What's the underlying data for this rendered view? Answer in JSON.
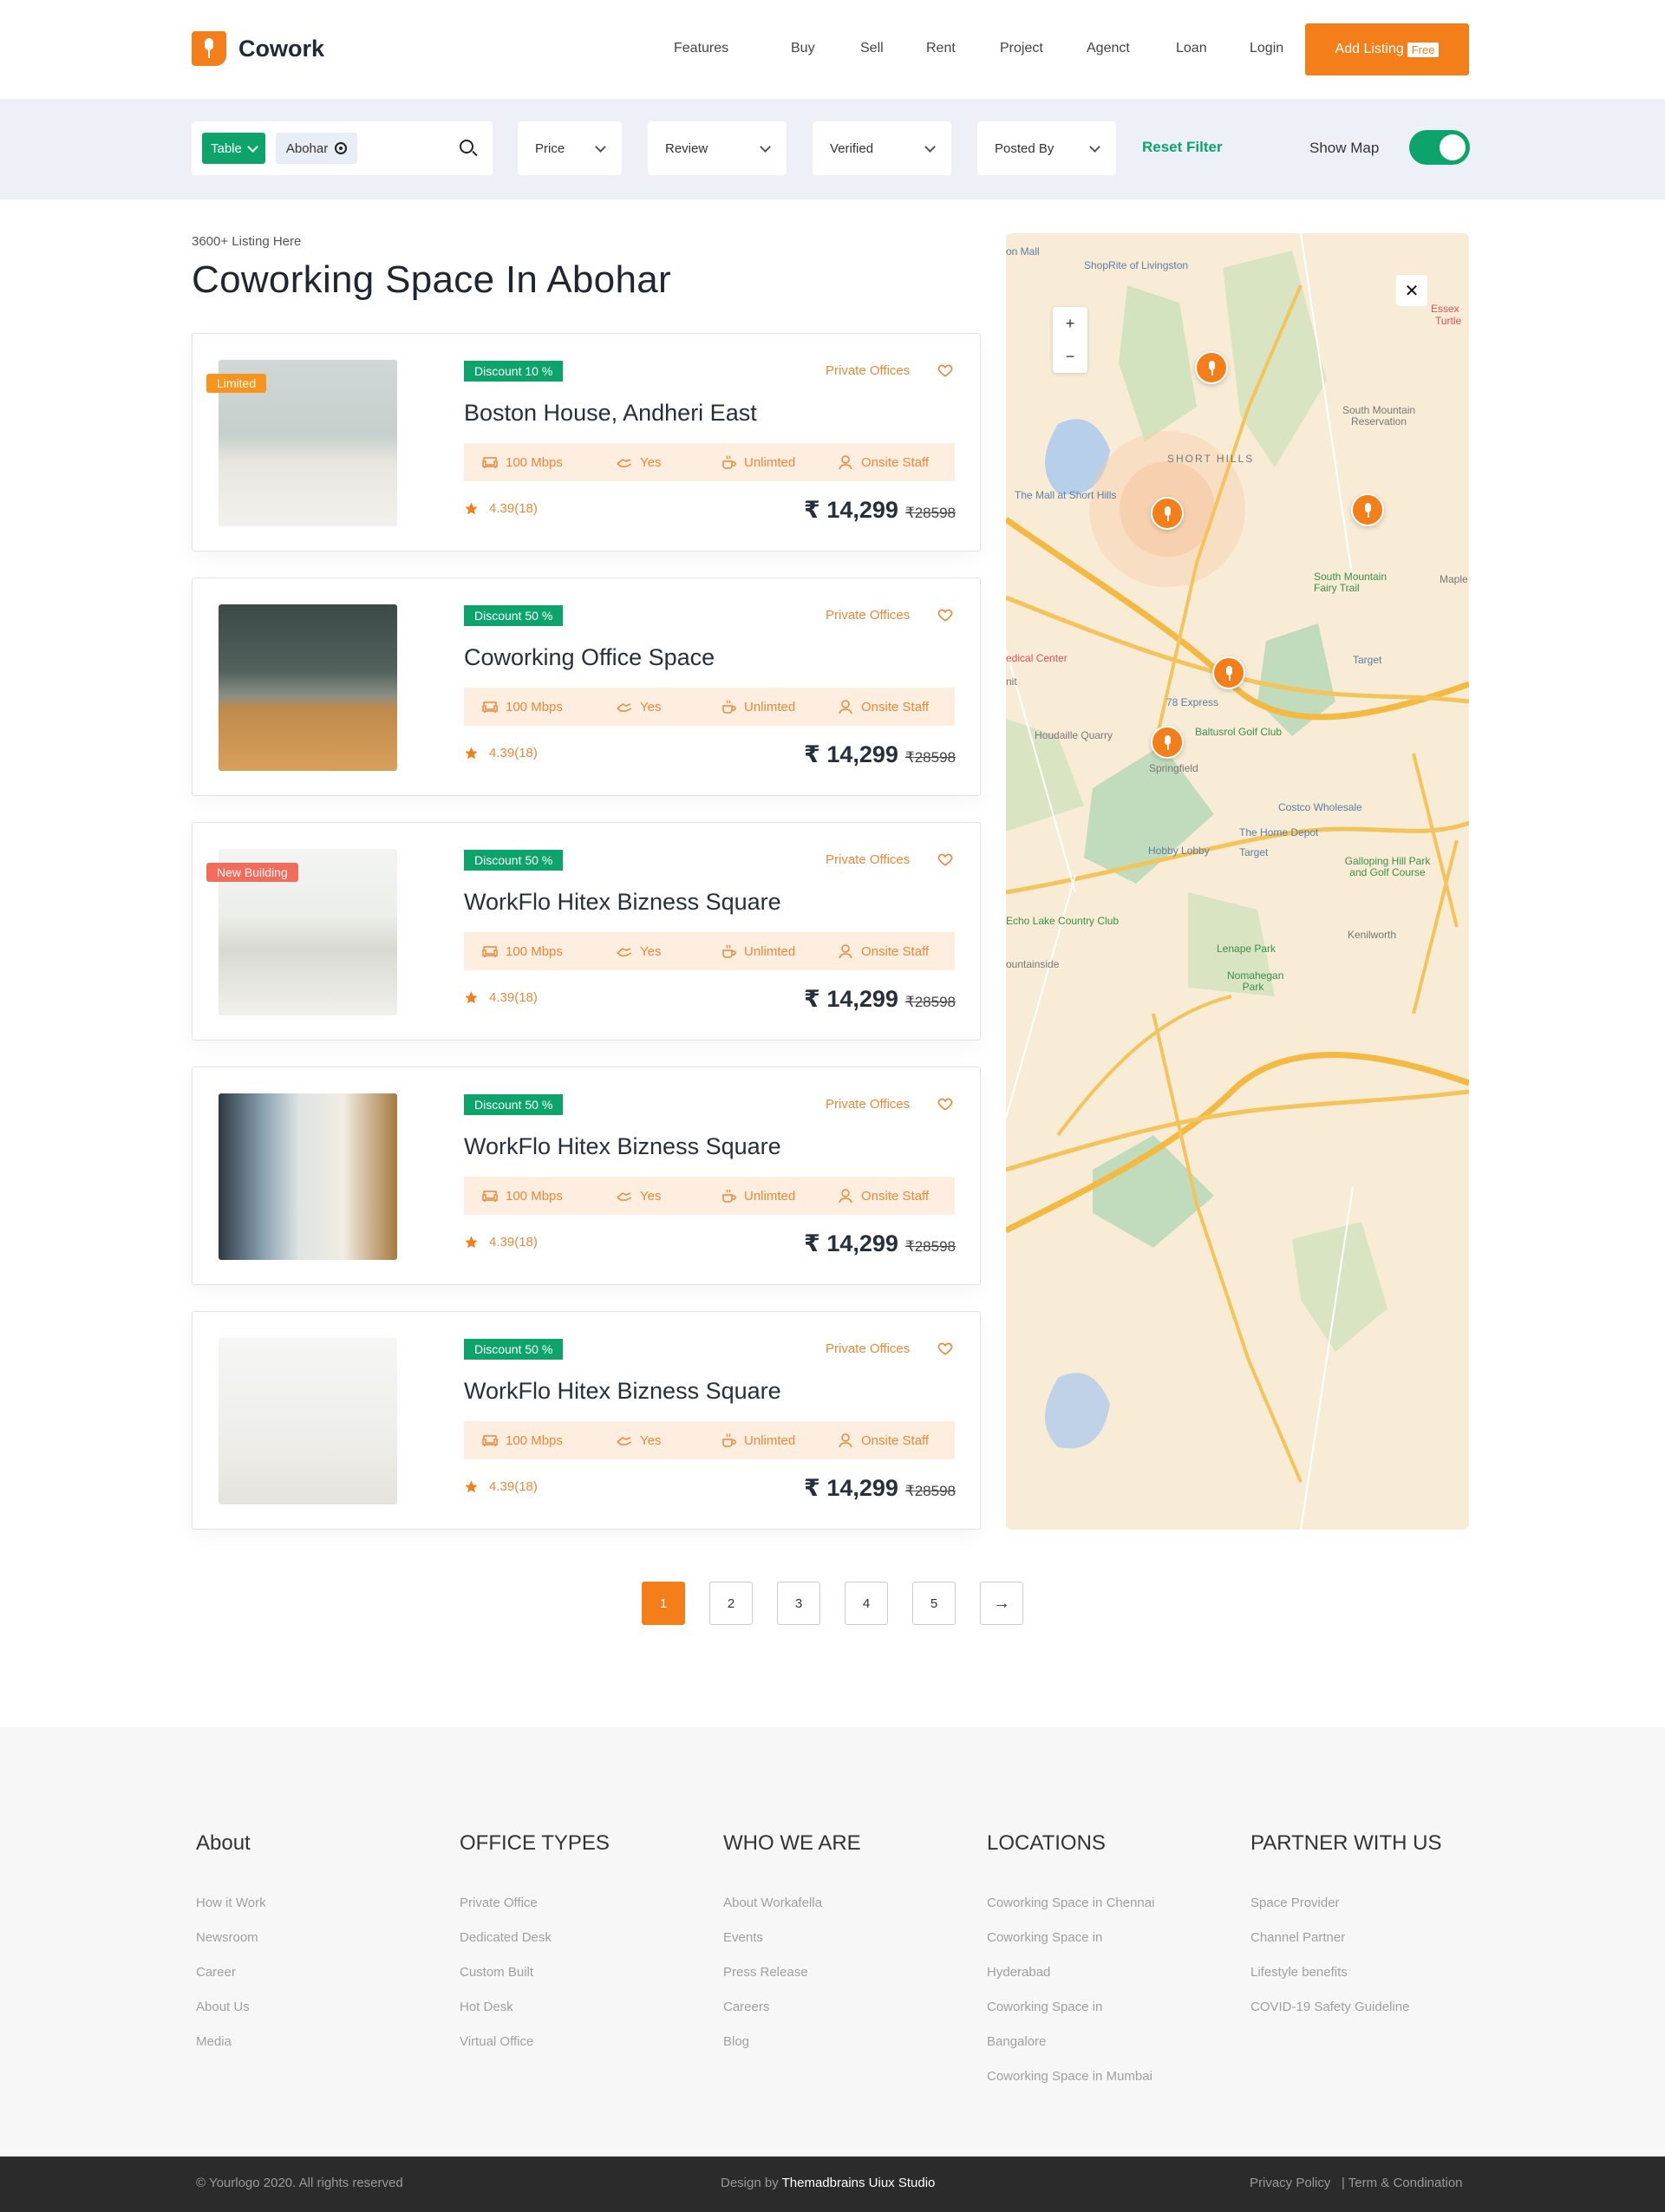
{
  "brand": {
    "name": "Cowork",
    "color": "#f47f1a",
    "accent": "#0da46b"
  },
  "nav": {
    "items": [
      "Features",
      "Buy",
      "Sell",
      "Rent",
      "Project",
      "Agenct",
      "Loan",
      "Login"
    ],
    "add_listing": "Add Listing",
    "add_listing_badge": "Free"
  },
  "filters": {
    "mode": "Table",
    "location": "Abohar",
    "price": "Price",
    "review": "Review",
    "verified": "Verified",
    "posted_by": "Posted By",
    "reset": "Reset Filter",
    "show_map": "Show Map",
    "show_map_on": true
  },
  "listing": {
    "count": "3600+ Listing Here",
    "title": "Coworking Space In Abohar"
  },
  "cards": [
    {
      "badge": "Limited",
      "badge_color": "#f7941d",
      "discount": "Discount 10 %",
      "type": "Private Offices",
      "title": "Boston House, Andheri East",
      "internet": "100 Mbps",
      "parking": "Yes",
      "coffee": "Unlimted",
      "staff": "Onsite Staff",
      "rating": "4.39(18)",
      "price": "₹ 14,299",
      "old_price": "₹28598",
      "image": "office-people"
    },
    {
      "badge": "",
      "badge_color": "",
      "discount": "Discount 50 %",
      "type": "Private Offices",
      "title": "Coworking Office Space",
      "internet": "100 Mbps",
      "parking": "Yes",
      "coffee": "Unlimted",
      "staff": "Onsite Staff",
      "rating": "4.39(18)",
      "price": "₹ 14,299",
      "old_price": "₹28598",
      "image": "empty-room"
    },
    {
      "badge": "New Building",
      "badge_color": "#f26b5b",
      "discount": "Discount 50 %",
      "type": "Private Offices",
      "title": "WorkFlo Hitex Bizness Square",
      "internet": "100 Mbps",
      "parking": "Yes",
      "coffee": "Unlimted",
      "staff": "Onsite Staff",
      "rating": "4.39(18)",
      "price": "₹ 14,299",
      "old_price": "₹28598",
      "image": "lounge"
    },
    {
      "badge": "",
      "badge_color": "",
      "discount": "Discount 50 %",
      "type": "Private Offices",
      "title": "WorkFlo Hitex Bizness Square",
      "internet": "100 Mbps",
      "parking": "Yes",
      "coffee": "Unlimted",
      "staff": "Onsite Staff",
      "rating": "4.39(18)",
      "price": "₹ 14,299",
      "old_price": "₹28598",
      "image": "glass-office"
    },
    {
      "badge": "",
      "badge_color": "",
      "discount": "Discount 50 %",
      "type": "Private Offices",
      "title": "WorkFlo Hitex Bizness Square",
      "internet": "100 Mbps",
      "parking": "Yes",
      "coffee": "Unlimted",
      "staff": "Onsite Staff",
      "rating": "4.39(18)",
      "price": "₹ 14,299",
      "old_price": "₹28598",
      "image": "white-desk"
    }
  ],
  "map": {
    "labels": [
      "on Mall",
      "ShopRite of Livingston",
      "Essex",
      "Turtle",
      "SHORT HILLS",
      "South Mountain Reservation",
      "The Mall at Short Hills",
      "South Mountain Fairy Trail",
      "Maple",
      "edical Center",
      "nit",
      "Target",
      "78 Express",
      "Houdaille Quarry",
      "Baltusrol Golf Club",
      "Springfield",
      "Costco Wholesale",
      "The Home Depot",
      "Hobby Lobby",
      "Target",
      "Galloping Hill Park and Golf Course",
      "Echo Lake Country Club",
      "Kenilworth",
      "Lenape Park",
      "Nomahegan Park",
      "ountainside"
    ],
    "close": "✕",
    "zoom_in": "+",
    "zoom_out": "−"
  },
  "pagination": {
    "pages": [
      "1",
      "2",
      "3",
      "4",
      "5"
    ],
    "active": "1",
    "next": "→"
  },
  "footer": {
    "columns": [
      {
        "title": "About",
        "links": [
          "How it Work",
          "Newsroom",
          "Career",
          "About Us",
          "Media"
        ]
      },
      {
        "title": "OFFICE TYPES",
        "links": [
          "Private Office",
          "Dedicated Desk",
          "Custom Built",
          "Hot Desk",
          "Virtual Office"
        ]
      },
      {
        "title": "WHO WE ARE",
        "links": [
          "About Workafella",
          "Events",
          "Press Release",
          "Careers",
          "Blog"
        ]
      },
      {
        "title": "LOCATIONS",
        "links": [
          "Coworking Space in Chennai",
          "Coworking Space in",
          "Hyderabad",
          "Coworking Space in",
          "Bangalore",
          "Coworking Space in Mumbai"
        ]
      },
      {
        "title": "PARTNER WITH US",
        "links": [
          "Space Provider",
          "Channel Partner",
          "Lifestyle benefits",
          "COVID-19 Safety Guideline"
        ]
      }
    ],
    "copyright": "© Yourlogo 2020. All rights reserved",
    "design_by": "Design by",
    "studio": "Themadbrains Uiux Studio",
    "privacy": "Privacy Policy",
    "terms": "| Term & Condination"
  }
}
